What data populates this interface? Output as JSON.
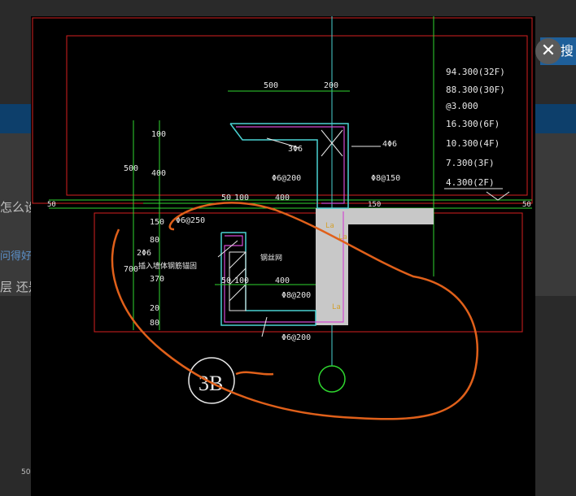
{
  "background": {
    "search_icon": "search-icon",
    "search_text": "搜",
    "text_line1": "怎么设",
    "text_line2": "问得好",
    "text_line3": "层 还是",
    "corner_label": "50"
  },
  "viewer": {
    "close_icon": "close-icon",
    "close_glyph": "✕",
    "elevations": [
      "94.300(32F)",
      "88.300(30F)",
      "@3.000",
      "16.300(6F)",
      "10.300(4F)",
      "7.300(3F)",
      "4.300(2F)"
    ],
    "dims": {
      "top_500": "500",
      "top_200": "200",
      "left_100": "100",
      "left_400": "400",
      "left_500": "500",
      "left_150": "150",
      "left_80a": "80",
      "left_700": "700",
      "left_370": "370",
      "left_20": "20",
      "left_80b": "80",
      "mid_50a": "50",
      "mid_100a": "100",
      "mid_400a": "400",
      "mid_50b": "50",
      "mid_100b": "100",
      "mid_400b": "400",
      "edge_50l": "50",
      "edge_50r": "50",
      "edge_150": "150"
    },
    "rebar": {
      "r_3d6": "3Φ6",
      "r_4d6": "4Φ6",
      "r_d6_200a": "Φ6@200",
      "r_d8_150": "Φ8@150",
      "r_d6_250": "Φ6@250",
      "r_2d6": "2Φ6",
      "r_note": "插入墙体钢筋锚固",
      "r_mesh": "钢丝网",
      "r_d8_200": "Φ8@200",
      "r_d6_200b": "Φ6@200",
      "la1": "La",
      "la2": "La",
      "la3": "La"
    },
    "detail_mark": "3B"
  },
  "colors": {
    "cad_green": "#2fd62f",
    "cad_yellow": "#e8e84a",
    "cad_magenta": "#d24ad2",
    "cad_red": "#d62020",
    "cad_cyan": "#4ad2d2",
    "cad_white": "#e8e8e8",
    "annotation_orange": "#e0601a",
    "concrete_gray": "#c8c8c8"
  }
}
